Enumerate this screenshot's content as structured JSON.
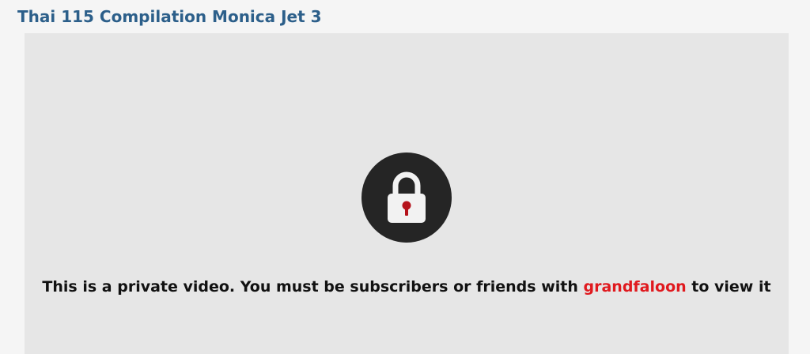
{
  "video": {
    "title": "Thai 115 Compilation Monica Jet 3"
  },
  "player": {
    "lock_icon": "padlock-icon",
    "message_before": "This is a private video. You must be subscribers or friends with ",
    "owner_username": "grandfaloon",
    "message_after": " to view it"
  },
  "colors": {
    "title": "#2c5f8a",
    "player_background": "#e6e6e6",
    "lock_badge": "#252525",
    "lock_body": "#f2f2f2",
    "keyhole": "#b5121b",
    "owner_link": "#e0191e"
  }
}
